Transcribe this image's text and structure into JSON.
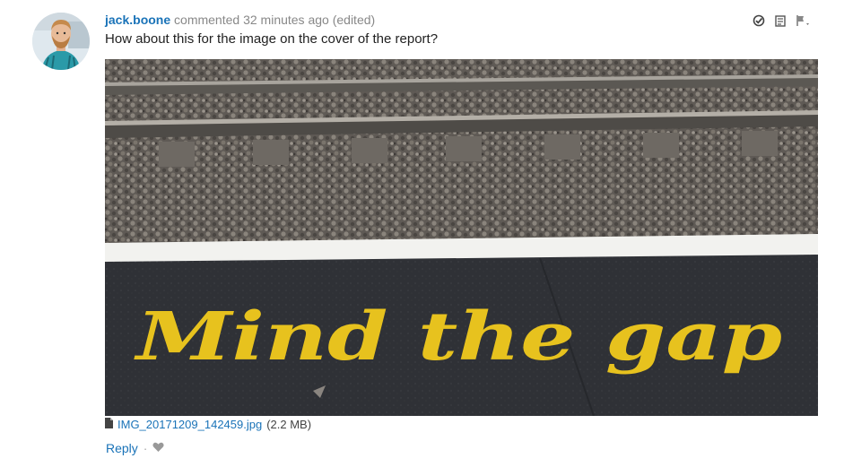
{
  "comment": {
    "author": "jack.boone",
    "action": "commented",
    "time": "32 minutes ago",
    "edited": "(edited)",
    "text": "How about this for the image on the cover of the report?"
  },
  "photo": {
    "painted_text": "Mind the gap"
  },
  "attachment": {
    "filename": "IMG_20171209_142459.jpg",
    "size": "(2.2 MB)",
    "icon": "file-icon"
  },
  "footer": {
    "reply_label": "Reply",
    "separator": "·"
  },
  "icons": {
    "resolve": "check-circle-icon",
    "edit": "edit-icon",
    "flag": "flag-icon",
    "like": "heart-icon"
  },
  "colors": {
    "link": "#1a73b8",
    "meta": "#888888"
  }
}
